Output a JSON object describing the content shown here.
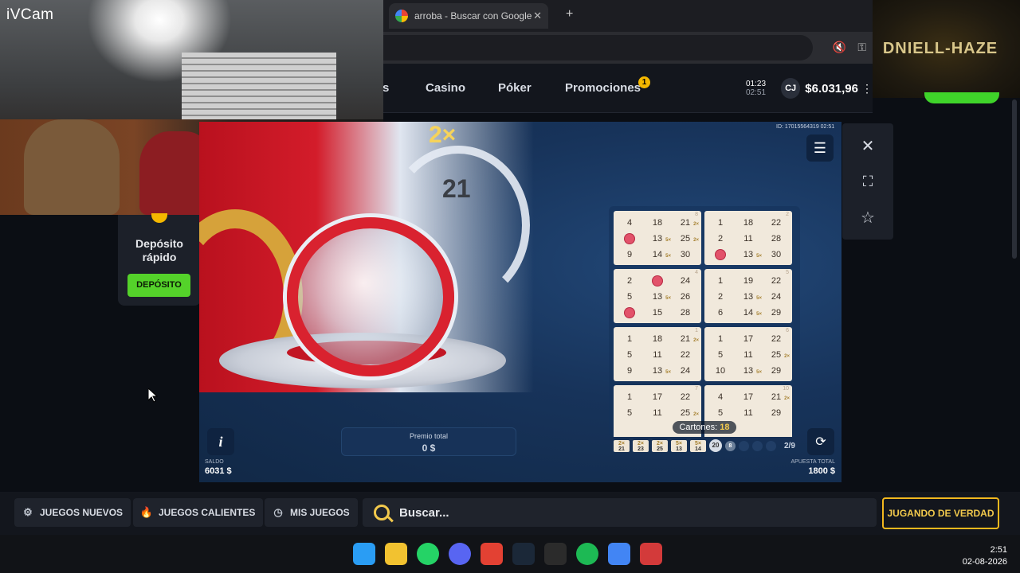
{
  "browser": {
    "tab_title": "arroba - Buscar con Google",
    "tab_close": "✕",
    "new_tab": "+"
  },
  "site": {
    "nav": [
      "s",
      "Casino",
      "Póker",
      "Promociones"
    ],
    "promo_badge": "1",
    "time_main": "01:23",
    "time_sub": "02:51",
    "avatar": "CJ",
    "balance": "$6.031,96"
  },
  "stream": {
    "ivcam_label": "iVCam",
    "brand_name": "DNIELL-HAZE"
  },
  "deposit": {
    "title": "Depósito rápido",
    "button": "DEPÓSITO"
  },
  "game": {
    "id": "ID: 17015564319 02:51",
    "top_multiplier": "2×",
    "drawn_ball": "21",
    "cards": [
      {
        "num": "8",
        "rows": [
          [
            "4",
            "18",
            "21"
          ],
          [
            "●",
            "13",
            "25"
          ],
          [
            "9",
            "14",
            "30"
          ]
        ],
        "marked": [
          [
            1,
            0
          ]
        ],
        "mult": [
          [
            0,
            2,
            "2×"
          ],
          [
            1,
            1,
            "5×"
          ],
          [
            1,
            2,
            "2×"
          ],
          [
            2,
            1,
            "5×"
          ]
        ]
      },
      {
        "num": "2",
        "rows": [
          [
            "1",
            "18",
            "22"
          ],
          [
            "2",
            "11",
            "28"
          ],
          [
            "●",
            "13",
            "30"
          ]
        ],
        "marked": [
          [
            2,
            0
          ]
        ],
        "mult": [
          [
            2,
            1,
            "5×"
          ]
        ]
      },
      {
        "num": "4",
        "rows": [
          [
            "2",
            "●",
            "24"
          ],
          [
            "5",
            "13",
            "26"
          ],
          [
            "●",
            "15",
            "28"
          ]
        ],
        "marked": [
          [
            0,
            1
          ],
          [
            2,
            0
          ]
        ],
        "mult": [
          [
            1,
            1,
            "5×"
          ]
        ]
      },
      {
        "num": "5",
        "rows": [
          [
            "1",
            "19",
            "22"
          ],
          [
            "2",
            "13",
            "24"
          ],
          [
            "6",
            "14",
            "29"
          ]
        ],
        "marked": [],
        "mult": [
          [
            1,
            1,
            "5×"
          ],
          [
            2,
            1,
            "5×"
          ]
        ]
      },
      {
        "num": "1",
        "rows": [
          [
            "1",
            "18",
            "21"
          ],
          [
            "5",
            "11",
            "22"
          ],
          [
            "9",
            "13",
            "24"
          ]
        ],
        "marked": [],
        "mult": [
          [
            0,
            2,
            "2×"
          ],
          [
            2,
            1,
            "5×"
          ]
        ]
      },
      {
        "num": "6",
        "rows": [
          [
            "1",
            "17",
            "22"
          ],
          [
            "5",
            "11",
            "25"
          ],
          [
            "10",
            "13",
            "29"
          ]
        ],
        "marked": [],
        "mult": [
          [
            1,
            2,
            "2×"
          ],
          [
            2,
            1,
            "5×"
          ]
        ]
      },
      {
        "num": "7",
        "rows": [
          [
            "1",
            "17",
            "22"
          ],
          [
            "5",
            "11",
            "25"
          ],
          [
            "",
            "",
            ""
          ]
        ],
        "marked": [],
        "mult": [
          [
            1,
            2,
            "2×"
          ]
        ]
      },
      {
        "num": "10",
        "rows": [
          [
            "4",
            "17",
            "21"
          ],
          [
            "5",
            "11",
            "29"
          ],
          [
            "",
            "",
            ""
          ]
        ],
        "marked": [],
        "mult": [
          [
            0,
            2,
            "2×"
          ]
        ]
      }
    ],
    "cartones_label": "Cartones:",
    "cartones_value": "18",
    "history": [
      {
        "m": "2×",
        "n": "21"
      },
      {
        "m": "2×",
        "n": "23"
      },
      {
        "m": "2×",
        "n": "25"
      },
      {
        "m": "5×",
        "n": "13"
      },
      {
        "m": "5×",
        "n": "14"
      }
    ],
    "current_ball": "20",
    "next_ball": "8",
    "pager": "2/9",
    "prize_label": "Premio total",
    "prize_value": "0 $",
    "saldo_label": "SALDO",
    "saldo_value": "6031 $",
    "apuesta_label": "APUESTA TOTAL",
    "apuesta_value": "1800 $"
  },
  "bottom": {
    "new_games": "JUEGOS NUEVOS",
    "hot_games": "JUEGOS CALIENTES",
    "my_games": "MIS JUEGOS",
    "search_placeholder": "Buscar...",
    "real_play": "JUGANDO DE VERDAD"
  },
  "taskbar": {
    "time": "2:51",
    "date": "02-08-2026",
    "icons": [
      "windows-icon",
      "explorer-icon",
      "whatsapp-icon",
      "discord-icon",
      "chrome-icon",
      "steam-icon",
      "obs-icon",
      "spotify-icon",
      "chrome-profile-icon",
      "ea-app-icon"
    ],
    "colors": [
      "#2a9df4",
      "#f2c230",
      "#25d366",
      "#5865f2",
      "#e34133",
      "#1b2838",
      "#2b2b2b",
      "#1db954",
      "#4285f4",
      "#d33a3a"
    ]
  }
}
